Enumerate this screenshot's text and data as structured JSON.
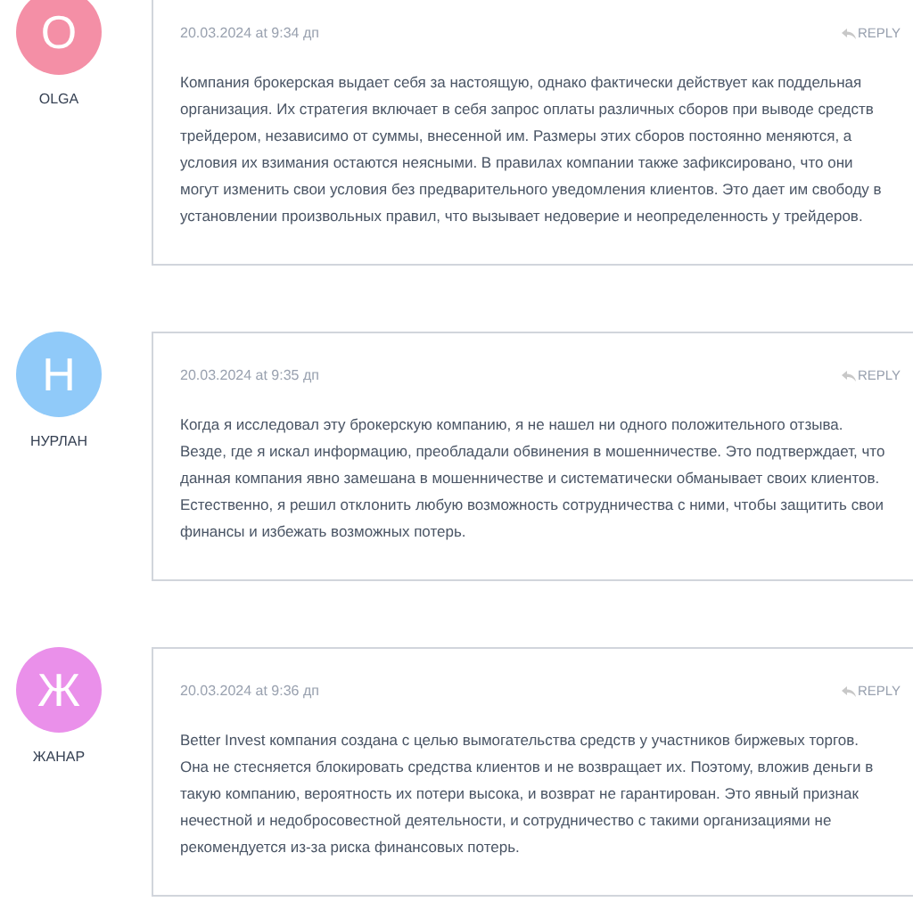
{
  "comments": [
    {
      "author": "OLGA",
      "initial": "O",
      "color": "#f48fa6",
      "date": "20.03.2024 at 9:34 дп",
      "reply": "REPLY",
      "text": "Компания брокерская выдает себя за настоящую, однако фактически действует как поддельная организация. Их стратегия включает в себя запрос оплаты различных сборов при выводе средств трейдером, независимо от суммы, внесенной им. Размеры этих сборов постоянно меняются, а условия их взимания остаются неясными. В правилах компании также зафиксировано, что они могут изменить свои условия без предварительного уведомления клиентов. Это дает им свободу в установлении произвольных правил, что вызывает недоверие и неопределенность у трейдеров."
    },
    {
      "author": "НУРЛАН",
      "initial": "Н",
      "color": "#90caf9",
      "date": "20.03.2024 at 9:35 дп",
      "reply": "REPLY",
      "text": "Когда я исследовал эту брокерскую компанию, я не нашел ни одного положительного отзыва. Везде, где я искал информацию, преобладали обвинения в мошенничестве. Это подтверждает, что данная компания явно замешана в мошенничестве и систематически обманывает своих клиентов. Естественно, я решил отклонить любую возможность сотрудничества с ними, чтобы защитить свои финансы и избежать возможных потерь."
    },
    {
      "author": "ЖАНАР",
      "initial": "Ж",
      "color": "#ea90ea",
      "date": "20.03.2024 at 9:36 дп",
      "reply": "REPLY",
      "text": "Better Invest компания создана с целью вымогательства средств у участников биржевых торгов. Она не стесняется блокировать средства клиентов и не возвращает их. Поэтому, вложив деньги в такую компанию, вероятность их потери высока, и возврат не гарантирован. Это явный признак нечестной и недобросовестной деятельности, и сотрудничество с такими организациями не рекомендуется из-за риска финансовых потерь."
    }
  ]
}
